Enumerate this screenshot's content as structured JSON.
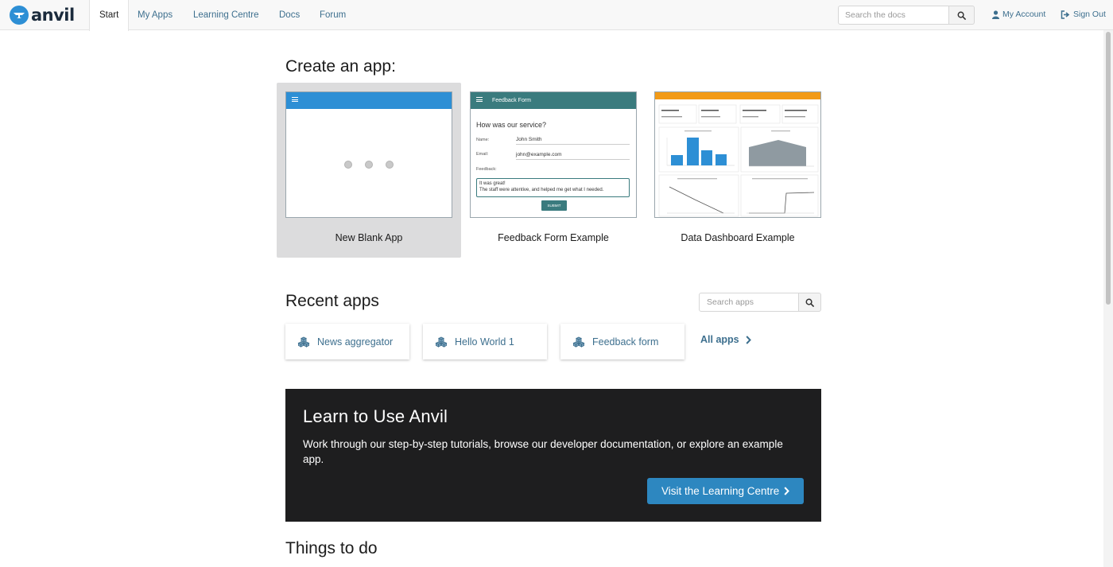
{
  "nav": {
    "logo_text": "anvil",
    "tabs": [
      {
        "label": "Start",
        "active": true
      },
      {
        "label": "My Apps"
      },
      {
        "label": "Learning Centre"
      },
      {
        "label": "Docs"
      },
      {
        "label": "Forum"
      }
    ],
    "search_placeholder": "Search the docs",
    "my_account": "My Account",
    "sign_out": "Sign Out",
    "icons": {
      "search": "search-icon",
      "account": "user-icon",
      "signout": "sign-out-icon"
    }
  },
  "create": {
    "heading": "Create an app:",
    "templates": [
      {
        "label": "New Blank App",
        "selected": true
      },
      {
        "label": "Feedback Form Example",
        "preview": {
          "title": "Feedback Form",
          "question": "How was our service?",
          "name_label": "Name:",
          "name_value": "John Smith",
          "email_label": "Email:",
          "email_value": "john@example.com",
          "feedback_label": "Feedback:",
          "feedback_line1": "It was great!",
          "feedback_line2": "The staff were attentive, and helped me get what I needed.",
          "submit": "SUBMIT"
        }
      },
      {
        "label": "Data Dashboard Example"
      }
    ]
  },
  "recent": {
    "heading": "Recent apps",
    "search_placeholder": "Search apps",
    "apps": [
      {
        "name": "News aggregator"
      },
      {
        "name": "Hello World 1"
      },
      {
        "name": "Feedback form"
      }
    ],
    "all_apps": "All apps"
  },
  "learn": {
    "title": "Learn to Use Anvil",
    "text": "Work through our step-by-step tutorials, browse our developer documentation, or explore an example app.",
    "button": "Visit the Learning Centre"
  },
  "todo": {
    "heading": "Things to do"
  },
  "colors": {
    "brand_blue": "#2d8fd5",
    "link": "#3d6f8e",
    "teal": "#3a7b7e",
    "orange": "#f29a17",
    "dark": "#1e1e1f"
  }
}
